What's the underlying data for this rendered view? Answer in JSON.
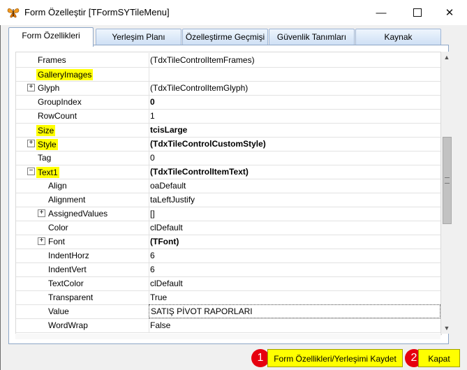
{
  "window": {
    "title": "Form Özelleştir [TFormSYTileMenu]",
    "minimize": "—",
    "close": "✕"
  },
  "tabs": [
    {
      "label": "Form Özellikleri",
      "active": true
    },
    {
      "label": "Yerleşim Planı",
      "active": false
    },
    {
      "label": "Özelleştirme Geçmişi",
      "active": false
    },
    {
      "label": "Güvenlik Tanımları",
      "active": false
    },
    {
      "label": "Kaynak",
      "active": false
    }
  ],
  "properties": [
    {
      "name": "Frames",
      "value": "(TdxTileControlItemFrames)",
      "level": 0,
      "expander": "",
      "highlight": false,
      "bold": false
    },
    {
      "name": "GalleryImages",
      "value": "",
      "level": 0,
      "expander": "",
      "highlight": true,
      "bold": false
    },
    {
      "name": "Glyph",
      "value": "(TdxTileControlItemGlyph)",
      "level": 0,
      "expander": "+",
      "highlight": false,
      "bold": false
    },
    {
      "name": "GroupIndex",
      "value": "0",
      "level": 0,
      "expander": "",
      "highlight": false,
      "bold": true
    },
    {
      "name": "RowCount",
      "value": "1",
      "level": 0,
      "expander": "",
      "highlight": false,
      "bold": false
    },
    {
      "name": "Size",
      "value": "tcisLarge",
      "level": 0,
      "expander": "",
      "highlight": true,
      "bold": true
    },
    {
      "name": "Style",
      "value": "(TdxTileControlCustomStyle)",
      "level": 0,
      "expander": "+",
      "highlight": true,
      "bold": true
    },
    {
      "name": "Tag",
      "value": "0",
      "level": 0,
      "expander": "",
      "highlight": false,
      "bold": false
    },
    {
      "name": "Text1",
      "value": "(TdxTileControlItemText)",
      "level": 0,
      "expander": "−",
      "highlight": true,
      "bold": true
    },
    {
      "name": "Align",
      "value": "oaDefault",
      "level": 1,
      "expander": "",
      "highlight": false,
      "bold": false
    },
    {
      "name": "Alignment",
      "value": "taLeftJustify",
      "level": 1,
      "expander": "",
      "highlight": false,
      "bold": false
    },
    {
      "name": "AssignedValues",
      "value": "[]",
      "level": 1,
      "expander": "+",
      "highlight": false,
      "bold": false
    },
    {
      "name": "Color",
      "value": "clDefault",
      "level": 1,
      "expander": "",
      "highlight": false,
      "bold": false
    },
    {
      "name": "Font",
      "value": "(TFont)",
      "level": 1,
      "expander": "+",
      "highlight": false,
      "bold": true
    },
    {
      "name": "IndentHorz",
      "value": "6",
      "level": 1,
      "expander": "",
      "highlight": false,
      "bold": false
    },
    {
      "name": "IndentVert",
      "value": "6",
      "level": 1,
      "expander": "",
      "highlight": false,
      "bold": false
    },
    {
      "name": "TextColor",
      "value": "clDefault",
      "level": 1,
      "expander": "",
      "highlight": false,
      "bold": false
    },
    {
      "name": "Transparent",
      "value": "True",
      "level": 1,
      "expander": "",
      "highlight": false,
      "bold": false
    },
    {
      "name": "Value",
      "value": "SATIŞ PİVOT RAPORLARI",
      "level": 1,
      "expander": "",
      "highlight": false,
      "bold": false,
      "editing": true
    },
    {
      "name": "WordWrap",
      "value": "False",
      "level": 1,
      "expander": "",
      "highlight": false,
      "bold": false
    }
  ],
  "buttons": {
    "save_label": "Form Özellikleri/Yerleşimi Kaydet",
    "close_label": "Kapat",
    "badge_1": "1",
    "badge_2": "2"
  },
  "colors": {
    "highlight": "#ffff00",
    "badge": "#e6000f",
    "tab_border": "#8da6c6"
  },
  "icons": {
    "app": "butterfly-icon",
    "expand": "plus-box-icon",
    "collapse": "minus-box-icon"
  }
}
